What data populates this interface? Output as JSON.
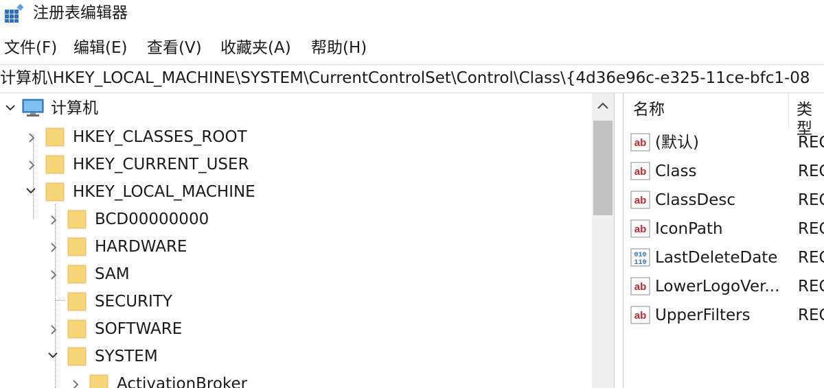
{
  "window": {
    "title": "注册表编辑器"
  },
  "menu": {
    "file": "文件(F)",
    "edit": "编辑(E)",
    "view": "查看(V)",
    "favorites": "收藏夹(A)",
    "help": "帮助(H)"
  },
  "address": {
    "path": "计算机\\HKEY_LOCAL_MACHINE\\SYSTEM\\CurrentControlSet\\Control\\Class\\{4d36e96c-e325-11ce-bfc1-08"
  },
  "tree": {
    "root": {
      "label": "计算机",
      "icon": "computer-icon",
      "expanded": true
    },
    "items": [
      {
        "label": "HKEY_CLASSES_ROOT",
        "state": "collapsed"
      },
      {
        "label": "HKEY_CURRENT_USER",
        "state": "collapsed"
      },
      {
        "label": "HKEY_LOCAL_MACHINE",
        "state": "expanded"
      },
      {
        "label": "BCD00000000",
        "state": "collapsed"
      },
      {
        "label": "HARDWARE",
        "state": "collapsed"
      },
      {
        "label": "SAM",
        "state": "collapsed"
      },
      {
        "label": "SECURITY",
        "state": "leaf"
      },
      {
        "label": "SOFTWARE",
        "state": "collapsed"
      },
      {
        "label": "SYSTEM",
        "state": "expanded"
      },
      {
        "label": "ActivationBroker",
        "state": "collapsed"
      }
    ]
  },
  "list": {
    "headers": {
      "name": "名称",
      "type": "类型"
    },
    "rows": [
      {
        "name": "(默认)",
        "type": "REG",
        "icon": "string-value-icon"
      },
      {
        "name": "Class",
        "type": "REG",
        "icon": "string-value-icon"
      },
      {
        "name": "ClassDesc",
        "type": "REG",
        "icon": "string-value-icon"
      },
      {
        "name": "IconPath",
        "type": "REG",
        "icon": "string-value-icon"
      },
      {
        "name": "LastDeleteDate",
        "type": "REG",
        "icon": "binary-value-icon"
      },
      {
        "name": "LowerLogoVer...",
        "type": "REG",
        "icon": "string-value-icon"
      },
      {
        "name": "UpperFilters",
        "type": "REG",
        "icon": "string-value-icon"
      }
    ]
  },
  "colors": {
    "folder": "#f6d57a",
    "folder_dark": "#e8bd4d",
    "scroll_thumb": "#c1c1c1",
    "ab_red": "#c9252c",
    "icon_blue": "#2a6fc9"
  }
}
